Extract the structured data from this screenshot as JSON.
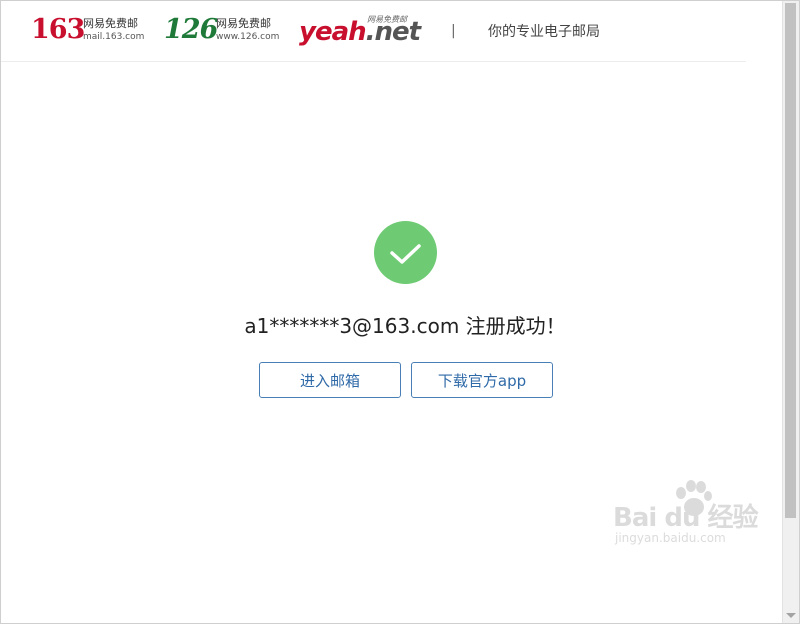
{
  "header": {
    "logo_163": {
      "number": "163",
      "label": "网易免费邮",
      "domain": "mail.163.com"
    },
    "logo_126": {
      "number": "126",
      "label": "网易免费邮",
      "domain": "www.126.com"
    },
    "logo_yeah": {
      "brand": "yeah",
      "suffix": ".net",
      "tag": "网易免费邮"
    },
    "divider": "|",
    "slogan": "你的专业电子邮局"
  },
  "main": {
    "success_message": "a1*******3@163.com 注册成功！",
    "enter_mailbox_label": "进入邮箱",
    "download_app_label": "下载官方app"
  },
  "watermark": {
    "logo": "Bai du 经验",
    "url": "jingyan.baidu.com"
  },
  "colors": {
    "brand_163": "#c8102e",
    "brand_126": "#1f7a3a",
    "success_green": "#6ecb74",
    "button_blue": "#2f6aa8"
  },
  "icons": {
    "success": "checkmark-circle-icon"
  }
}
